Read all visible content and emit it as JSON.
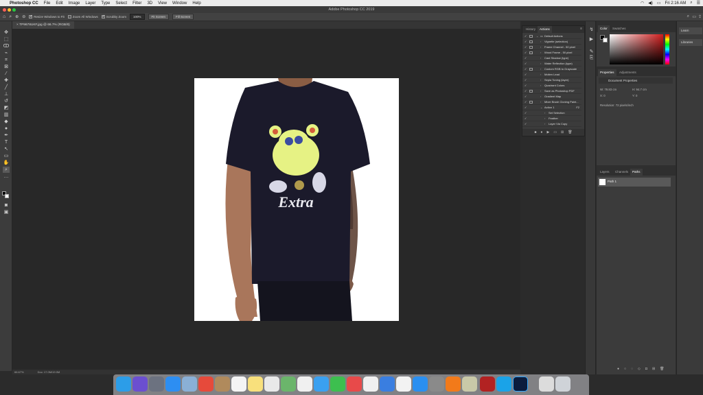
{
  "menubar": {
    "app_name": "Photoshop CC",
    "items": [
      "File",
      "Edit",
      "Image",
      "Layer",
      "Type",
      "Select",
      "Filter",
      "3D",
      "View",
      "Window",
      "Help"
    ],
    "clock": "Fri 2:16 AM"
  },
  "window": {
    "title": "Adobe Photoshop CC 2019"
  },
  "options_bar": {
    "resize_windows_label": "Resize Windows to Fit",
    "zoom_all_label": "Zoom All Windows",
    "scrubby_label": "Scrubby Zoom",
    "zoom_value": "100%",
    "fit_screen_label": "Fit Screen",
    "fill_screen_label": "Fill Screen"
  },
  "document_tab": {
    "label": "TP9678UKF.jpg @ 66.7% (RGB/8)"
  },
  "status": {
    "zoom": "66.67%",
    "doc": "Doc: 17.0M/19.0M"
  },
  "actions_panel": {
    "tabs": [
      "History",
      "Actions"
    ],
    "rows": [
      {
        "name": "Default Actions",
        "indent": 0,
        "folder": true,
        "dialog": true,
        "key": ""
      },
      {
        "name": "Vignette (selection)",
        "indent": 1,
        "dialog": true,
        "key": ""
      },
      {
        "name": "Frame Channel - 50 pixel",
        "indent": 1,
        "dialog": true,
        "key": ""
      },
      {
        "name": "Wood Frame - 50 pixel",
        "indent": 1,
        "dialog": true,
        "key": ""
      },
      {
        "name": "Cast Shadow (type)",
        "indent": 1,
        "dialog": false,
        "key": ""
      },
      {
        "name": "Water Reflection (type)",
        "indent": 1,
        "dialog": false,
        "key": ""
      },
      {
        "name": "Custom RGB to Grayscale",
        "indent": 1,
        "dialog": true,
        "key": ""
      },
      {
        "name": "Molten Lead",
        "indent": 1,
        "dialog": false,
        "key": ""
      },
      {
        "name": "Sepia Toning (layer)",
        "indent": 1,
        "dialog": false,
        "key": ""
      },
      {
        "name": "Quadrant Colors",
        "indent": 1,
        "dialog": false,
        "key": ""
      },
      {
        "name": "Save as Photoshop PDF",
        "indent": 1,
        "dialog": true,
        "key": ""
      },
      {
        "name": "Gradient Map",
        "indent": 1,
        "dialog": false,
        "key": ""
      },
      {
        "name": "Mixer Brush Cloning Paint...",
        "indent": 1,
        "dialog": true,
        "key": ""
      },
      {
        "name": "Action 1",
        "indent": 1,
        "dialog": false,
        "key": "F2"
      },
      {
        "name": "Set Selection",
        "indent": 2,
        "dialog": false,
        "key": ""
      },
      {
        "name": "Feather",
        "indent": 2,
        "dialog": false,
        "key": ""
      },
      {
        "name": "Layer Via Copy",
        "indent": 2,
        "dialog": false,
        "key": ""
      }
    ]
  },
  "color_panel": {
    "tabs": [
      "Color",
      "Swatches"
    ],
    "foreground": "#000000",
    "background": "#ffffff",
    "hue": "#d11c1c"
  },
  "properties_panel": {
    "tabs": [
      "Properties",
      "Adjustments"
    ],
    "section": "Document Properties",
    "w_label": "W:",
    "w_value": "79.83 cm",
    "h_label": "H:",
    "h_value": "94.7 cm",
    "x_label": "X:",
    "x_value": "0",
    "y_label": "Y:",
    "y_value": "0",
    "resolution": "Resolution: 72 pixels/inch"
  },
  "layers_panel": {
    "tabs": [
      "Layers",
      "Channels",
      "Paths"
    ],
    "path_name": "Path 1"
  },
  "far_right": {
    "learn": "Learn",
    "libraries": "Libraries"
  },
  "shirt_text": "Extra"
}
